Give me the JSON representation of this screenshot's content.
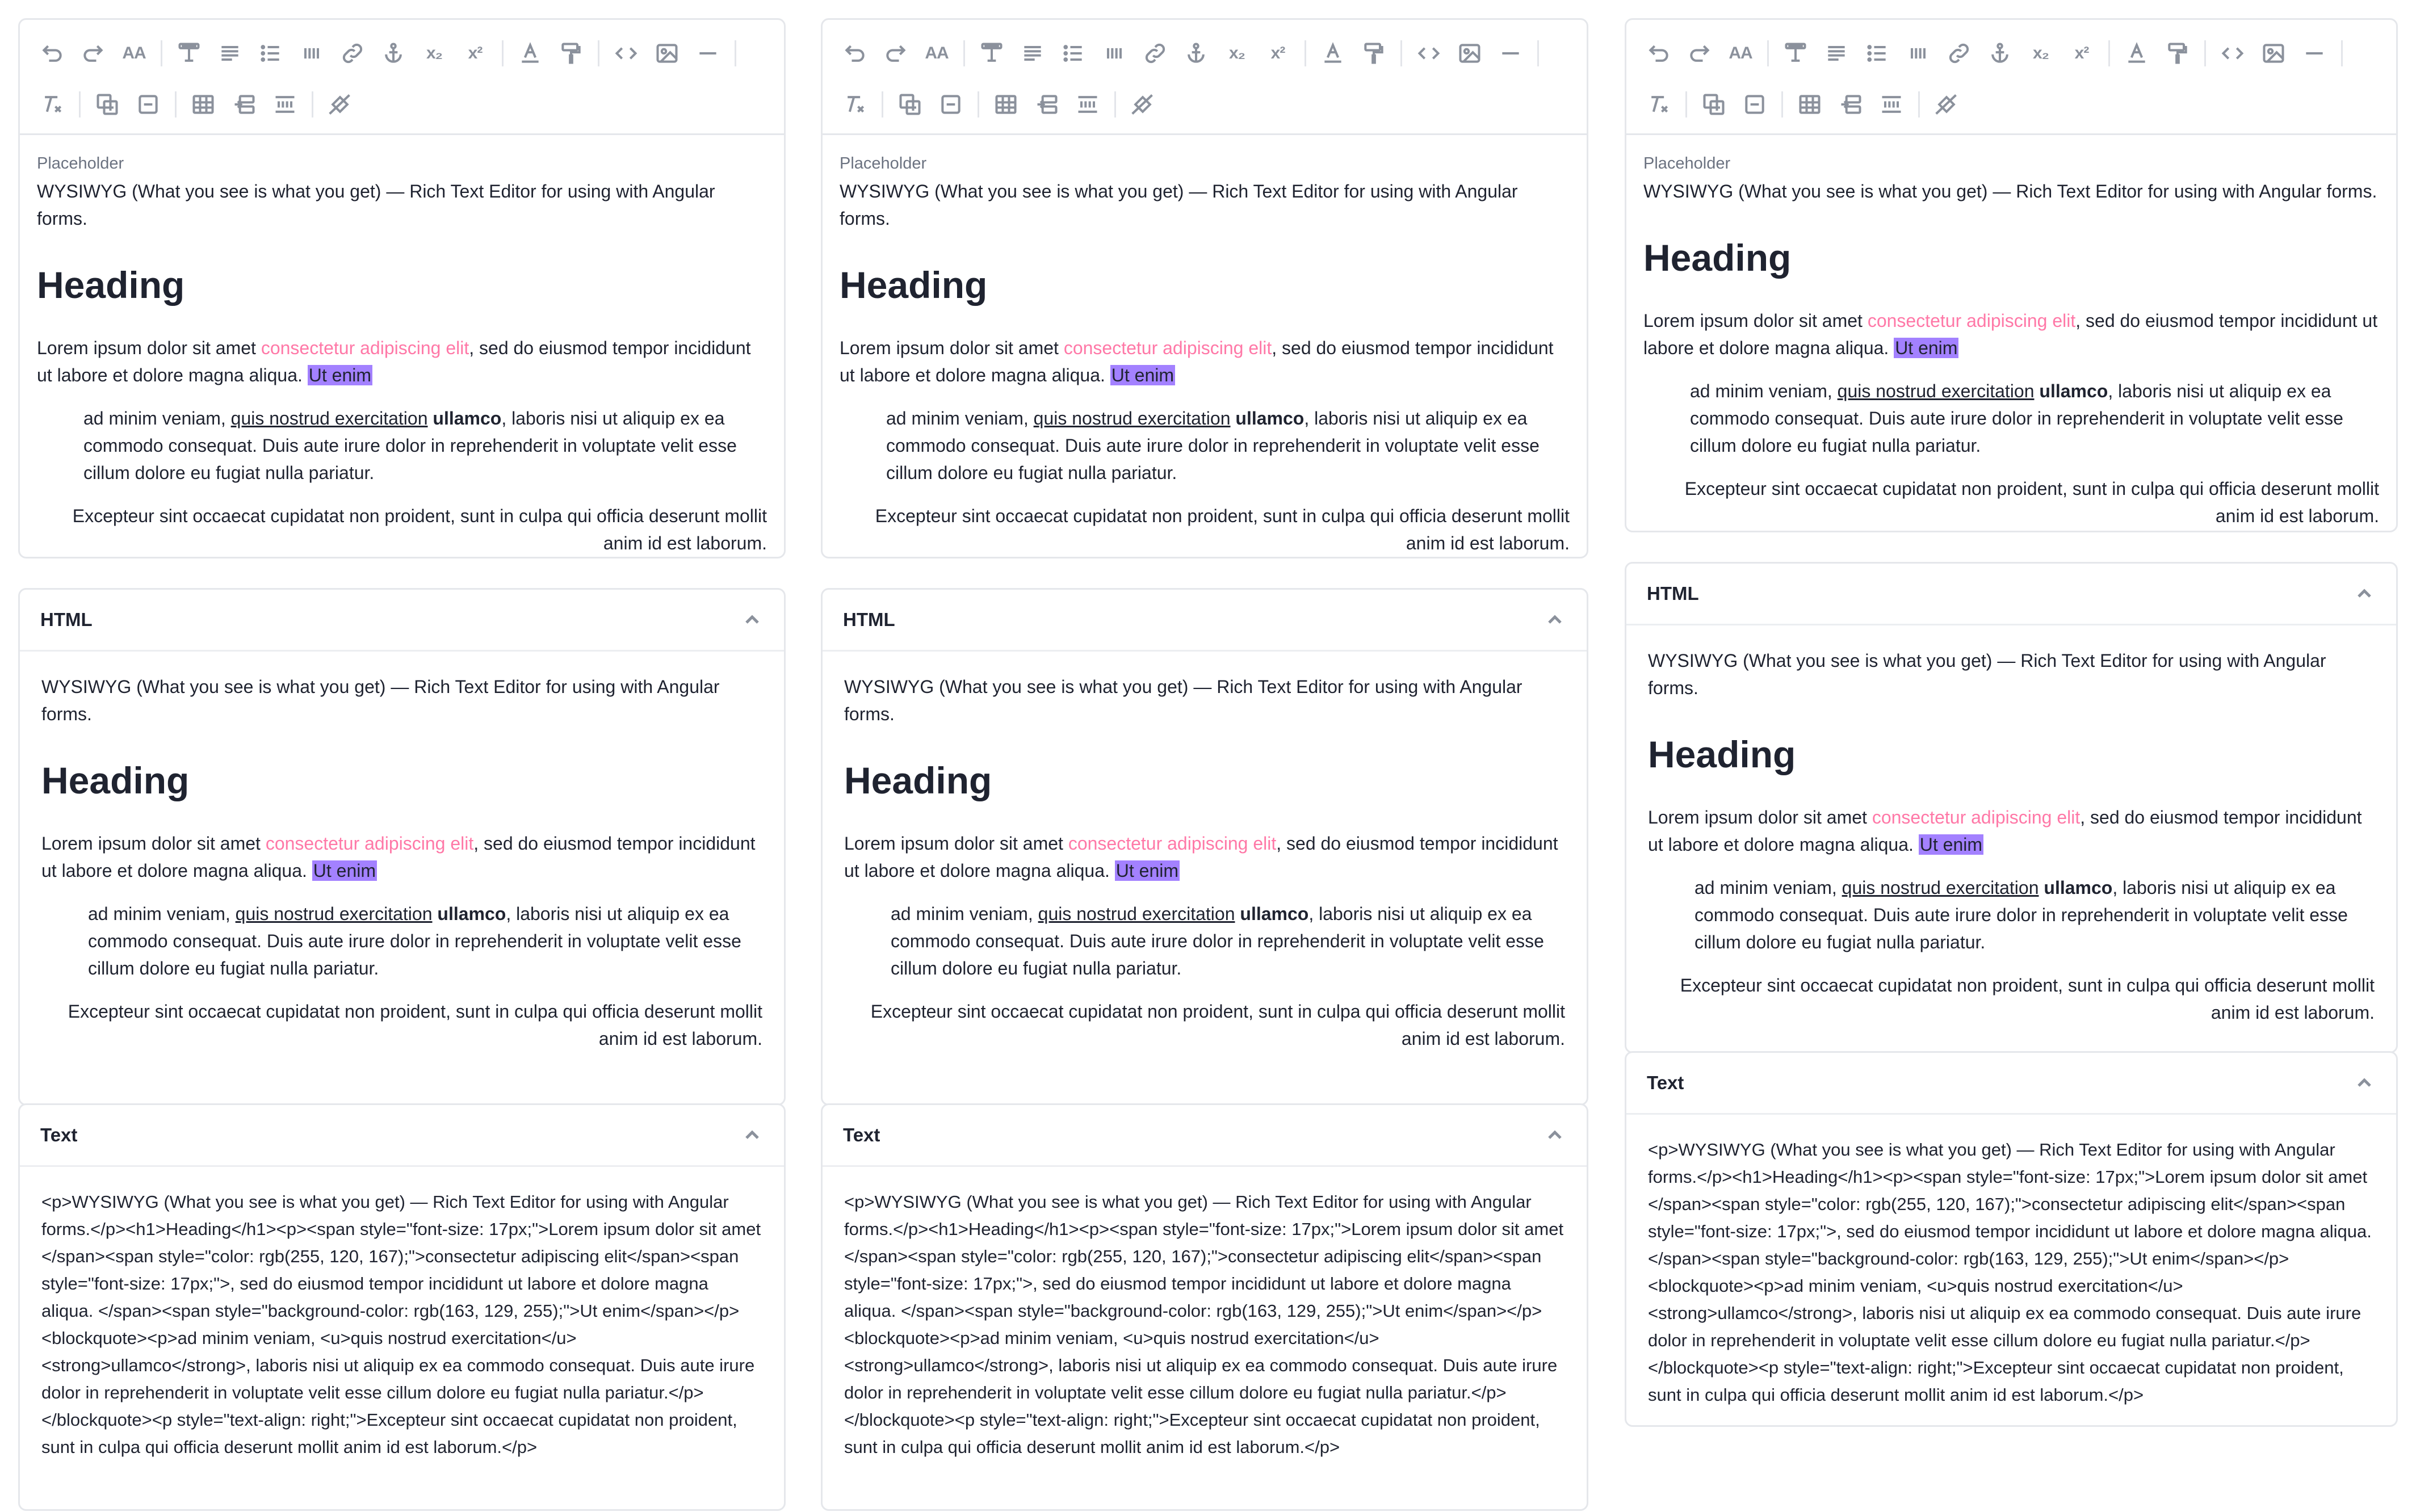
{
  "toolbar": {
    "icons": [
      "undo-icon",
      "redo-icon",
      "font-size-icon",
      "heading-icon",
      "align-icon",
      "bullet-list-icon",
      "quote-icon",
      "link-icon",
      "anchor-icon",
      "subscript-icon",
      "superscript-icon",
      "text-color-icon",
      "highlight-icon",
      "code-icon",
      "image-icon",
      "horizontal-rule-icon",
      "clear-format-icon",
      "insert-table-icon",
      "delete-table-icon",
      "table-icon",
      "cell-merge-icon",
      "cell-split-icon",
      "paint-bucket-icon"
    ],
    "font_size_label": "AA",
    "subscript_label": "x₂",
    "superscript_label": "x²"
  },
  "editor": {
    "placeholder": "Placeholder",
    "intro": "WYSIWYG (What you see is what you get) — Rich Text Editor for using with Angular forms.",
    "heading": "Heading",
    "lorem_before": "Lorem ipsum dolor sit amet ",
    "lorem_pink": "consectetur adipiscing elit",
    "lorem_after": ", sed do eiusmod tempor incididunt ut labore et dolore magna aliqua. ",
    "lorem_highlight": "Ut enim",
    "quote_start": "ad minim veniam, ",
    "quote_underline": "quis nostrud exercitation",
    "quote_bold": "ullamco",
    "quote_end": ", laboris nisi ut aliquip ex ea commodo consequat. Duis aute irure dolor in reprehenderit in voluptate velit esse cillum dolore eu fugiat nulla pariatur.",
    "right_text": "Excepteur sint occaecat cupidatat non proident, sunt in culpa qui officia deserunt mollit anim id est laborum."
  },
  "html_panel": {
    "title": "HTML"
  },
  "text_panel": {
    "title": "Text",
    "source": "<p>WYSIWYG (What you see is what you get) — Rich Text Editor for using with Angular forms.</p><h1>Heading</h1><p><span style=\"font-size: 17px;\">Lorem ipsum dolor sit amet </span><span style=\"color: rgb(255, 120, 167);\">consectetur adipiscing elit</span><span style=\"font-size: 17px;\">, sed do eiusmod tempor incididunt ut labore et dolore magna aliqua. </span><span style=\"background-color: rgb(163, 129, 255);\">Ut enim</span></p><blockquote><p>ad minim veniam, <u>quis nostrud exercitation</u> <strong>ullamco</strong>, laboris nisi ut aliquip ex ea commodo consequat. Duis aute irure dolor in reprehenderit in voluptate velit esse cillum dolore eu fugiat nulla pariatur.</p></blockquote><p style=\"text-align: right;\">Excepteur sint occaecat cupidatat non proident, sunt in culpa qui officia deserunt mollit anim id est laborum.</p>"
  },
  "colors": {
    "pink": "#ff78a7",
    "highlight": "#a381ff",
    "border": "#e5e7eb",
    "icon": "#8b919c"
  }
}
